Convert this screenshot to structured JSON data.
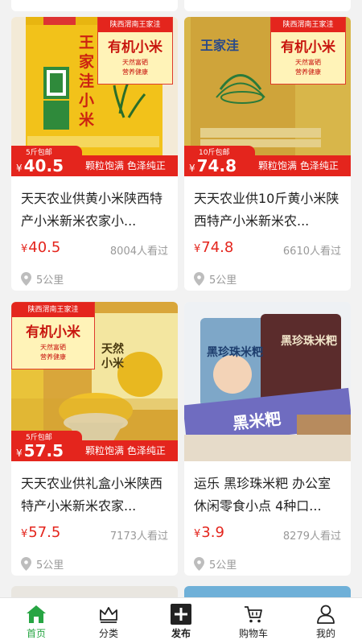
{
  "products": [
    {
      "badge": {
        "top": "陕西渭南王家洼",
        "main": "有机小米",
        "slogan1": "天然富硒",
        "slogan2": "营养健康"
      },
      "tag_sub": "5斤包邮",
      "tag_price": "40.5",
      "tag_right": "颗粒饱满 色泽纯正",
      "title": "天天农业供黄小米陕西特产小米新米农家小...",
      "price": "40.5",
      "views": "8004人看过",
      "distance": "5公里",
      "bag_text": "王家洼小米"
    },
    {
      "badge": {
        "top": "陕西渭南王家洼",
        "main": "有机小米",
        "slogan1": "天然富硒",
        "slogan2": "营养健康"
      },
      "tag_sub": "10斤包邮",
      "tag_price": "74.8",
      "tag_right": "颗粒饱满 色泽纯正",
      "title": "天天农业供10斤黄小米陕西特产小米新米农...",
      "price": "74.8",
      "views": "6610人看过",
      "distance": "5公里",
      "bag_text": "王家洼"
    },
    {
      "badge": {
        "top": "陕西渭南王家洼",
        "main": "有机小米",
        "slogan1": "天然富硒",
        "slogan2": "营养健康"
      },
      "tag_sub": "5斤包邮",
      "tag_price": "57.5",
      "tag_right": "颗粒饱满 色泽纯正",
      "title": "天天农业供礼盒小米陕西特产小米新米农家...",
      "price": "57.5",
      "views": "7173人看过",
      "distance": "5公里",
      "bag_text": "天然小米"
    },
    {
      "title": "运乐 黑珍珠米粑 办公室休闲零食小点 4种口...",
      "price": "3.9",
      "views": "8279人看过",
      "distance": "5公里",
      "pack_text": "黑珍珠米粑",
      "pack_text2": "黑米粑"
    }
  ],
  "currency": "¥",
  "tabs": [
    {
      "label": "首页",
      "icon": "home-icon",
      "active": true
    },
    {
      "label": "分类",
      "icon": "crown-icon",
      "active": false
    },
    {
      "label": "发布",
      "icon": "plus-icon",
      "active": false
    },
    {
      "label": "购物车",
      "icon": "cart-icon",
      "active": false
    },
    {
      "label": "我的",
      "icon": "user-icon",
      "active": false
    }
  ],
  "colors": {
    "accent": "#e4251d",
    "active_tab": "#27a543",
    "muted": "#999999"
  }
}
